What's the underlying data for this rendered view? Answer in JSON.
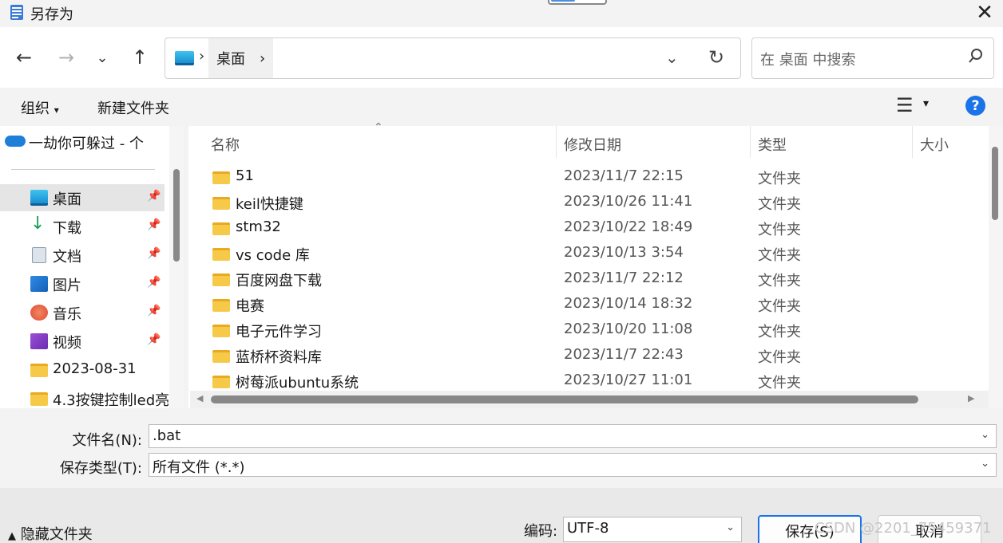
{
  "window": {
    "title": "另存为"
  },
  "nav": {
    "path_root_icon": "desktop-icon",
    "breadcrumb": "桌面",
    "search_placeholder": "在 桌面 中搜索"
  },
  "toolbar": {
    "organize": "组织",
    "new_folder": "新建文件夹"
  },
  "sidebar": {
    "onedrive": "一劫你可躲过 - 个",
    "items": [
      {
        "label": "桌面",
        "icon": "desktop-icon",
        "pinned": true,
        "selected": true
      },
      {
        "label": "下载",
        "icon": "download-icon",
        "pinned": true
      },
      {
        "label": "文档",
        "icon": "document-icon",
        "pinned": true
      },
      {
        "label": "图片",
        "icon": "picture-icon",
        "pinned": true
      },
      {
        "label": "音乐",
        "icon": "music-icon",
        "pinned": true
      },
      {
        "label": "视频",
        "icon": "video-icon",
        "pinned": true
      },
      {
        "label": "2023-08-31",
        "icon": "folder-icon"
      },
      {
        "label": "4.3按键控制led亮",
        "icon": "folder-icon"
      }
    ]
  },
  "list": {
    "columns": [
      "名称",
      "修改日期",
      "类型",
      "大小"
    ],
    "rows": [
      {
        "name": "51",
        "date": "2023/11/7 22:15",
        "type": "文件夹"
      },
      {
        "name": "keil快捷键",
        "date": "2023/10/26 11:41",
        "type": "文件夹"
      },
      {
        "name": "stm32",
        "date": "2023/10/22 18:49",
        "type": "文件夹"
      },
      {
        "name": "vs code 库",
        "date": "2023/10/13 3:54",
        "type": "文件夹"
      },
      {
        "name": "百度网盘下载",
        "date": "2023/11/7 22:12",
        "type": "文件夹"
      },
      {
        "name": "电赛",
        "date": "2023/10/14 18:32",
        "type": "文件夹"
      },
      {
        "name": "电子元件学习",
        "date": "2023/10/20 11:08",
        "type": "文件夹"
      },
      {
        "name": "蓝桥杯资料库",
        "date": "2023/11/7 22:43",
        "type": "文件夹"
      },
      {
        "name": "树莓派ubuntu系统",
        "date": "2023/10/27 11:01",
        "type": "文件夹"
      }
    ]
  },
  "form": {
    "filename_label": "文件名(N):",
    "filename_value": ".bat",
    "filetype_label": "保存类型(T):",
    "filetype_value": "所有文件  (*.*)"
  },
  "footer": {
    "hide_folders": "隐藏文件夹",
    "encoding_label": "编码:",
    "encoding_value": "UTF-8",
    "save": "保存(S)",
    "cancel": "取消",
    "watermark": "CSDN @2201_75459371"
  }
}
